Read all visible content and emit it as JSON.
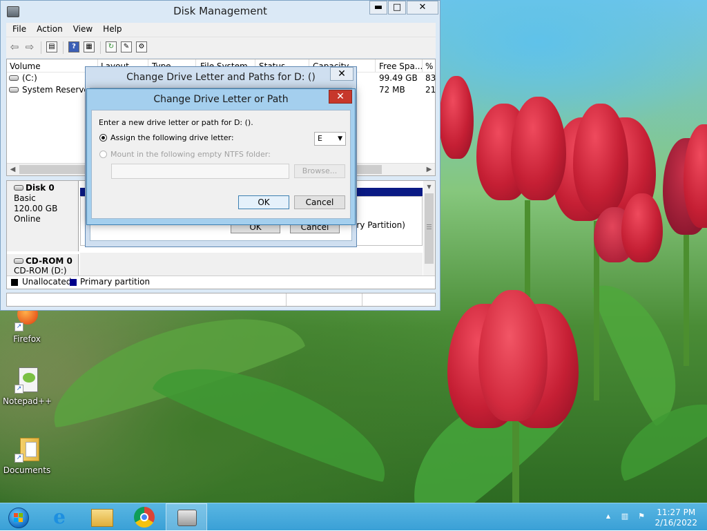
{
  "window": {
    "title": "Disk Management",
    "controls": {
      "minimize": "▬",
      "maximize": "□",
      "close": "✕"
    }
  },
  "menu": [
    "File",
    "Action",
    "View",
    "Help"
  ],
  "toolbar": {
    "icons": [
      "back-arrow-icon",
      "forward-arrow-icon",
      "console-tree-icon",
      "help-icon",
      "properties-icon",
      "refresh-icon",
      "export-icon",
      "settings-icon"
    ]
  },
  "volume_list": {
    "columns": [
      "Volume",
      "Layout",
      "Type",
      "File System",
      "Status",
      "Capacity",
      "Free Spa...",
      "% F"
    ],
    "rows": [
      {
        "volume": "(C:)",
        "free": "99.49 GB",
        "pct": "83"
      },
      {
        "volume": "System Reserved",
        "free": "72 MB",
        "pct": "21"
      }
    ]
  },
  "disks": [
    {
      "name": "Disk 0",
      "type": "Basic",
      "size": "120.00 GB",
      "status": "Online"
    },
    {
      "name": "CD-ROM 0",
      "type": "CD-ROM (D:)"
    }
  ],
  "partition_fragment": "ary Partition)",
  "legend": [
    {
      "label": "Unallocated",
      "color": "#000000"
    },
    {
      "label": "Primary partition",
      "color": "#00008b"
    }
  ],
  "outer_dialog": {
    "title": "Change Drive Letter and Paths for D: ()",
    "close": "✕",
    "ok": "OK",
    "cancel": "Cancel"
  },
  "inner_dialog": {
    "title": "Change Drive Letter or Path",
    "close": "✕",
    "prompt": "Enter a new drive letter or path for D: ().",
    "option_assign": "Assign the following drive letter:",
    "option_mount": "Mount in the following empty NTFS folder:",
    "drive_letter": "E",
    "browse": "Browse...",
    "ok": "OK",
    "cancel": "Cancel"
  },
  "desktop_icons": [
    {
      "label": "Firefox"
    },
    {
      "label": "Notepad++"
    },
    {
      "label": "Documents"
    }
  ],
  "taskbar": {
    "apps": [
      "start-button",
      "internet-explorer",
      "file-explorer",
      "chrome",
      "disk-management"
    ],
    "time": "11:27 PM",
    "date": "2/16/2022"
  }
}
